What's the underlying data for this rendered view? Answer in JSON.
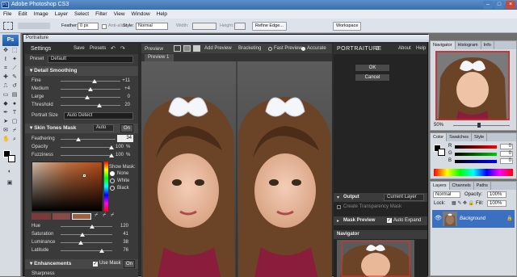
{
  "app": {
    "title": "Adobe Photoshop CS3",
    "logo": "Ps"
  },
  "menu": [
    "File",
    "Edit",
    "Image",
    "Layer",
    "Select",
    "Filter",
    "View",
    "Window",
    "Help"
  ],
  "options": {
    "feather_label": "Feather:",
    "feather_value": "0 px",
    "antialias": "Anti-alias",
    "style_label": "Style:",
    "style_value": "Normal",
    "width_label": "Width:",
    "height_label": "Height:",
    "refine": "Refine Edge...",
    "workspace": "Workspace"
  },
  "dialog": {
    "title": "Portraiture",
    "settings": {
      "header": "Settings",
      "save": "Save",
      "presets": "Presets",
      "preset_label": "Preset",
      "preset_value": "Default",
      "detail_header": "Detail Smoothing",
      "detail_rows": [
        {
          "label": "Fine",
          "value": "+11"
        },
        {
          "label": "Medium",
          "value": "+4"
        },
        {
          "label": "Large",
          "value": "0"
        },
        {
          "label": "Threshold",
          "value": "20"
        }
      ],
      "portrait_size_label": "Portrait Size",
      "portrait_size_value": "Auto Detect",
      "skin_header": "Skin Tones Mask",
      "skin_mode": "Auto",
      "skin_on": "On",
      "skin_rows": [
        {
          "label": "Feathering",
          "value": "34"
        },
        {
          "label": "Opacity",
          "value": "100",
          "unit": "%"
        },
        {
          "label": "Fuzziness",
          "value": "100",
          "unit": "%"
        }
      ],
      "show_mask_label": "Show Mask:",
      "show_mask_options": [
        "None",
        "White",
        "Black"
      ],
      "color_rows": [
        {
          "label": "Hue",
          "value": "120"
        },
        {
          "label": "Saturation",
          "value": "41"
        },
        {
          "label": "Luminance",
          "value": "38"
        },
        {
          "label": "Latitude",
          "value": "76"
        }
      ],
      "enh_header": "Enhancements",
      "use_mask": "Use Mask",
      "enh_on": "On",
      "sharpness_label": "Sharpness"
    },
    "preview": {
      "label": "Preview",
      "add_preview": "Add Preview",
      "bracketing": "Bracketing",
      "fast_preview": "Fast Preview",
      "accurate": "Accurate",
      "tab": "Preview 1"
    },
    "right": {
      "brand_a": "PORTRAITURE",
      "brand_b": "2",
      "about": "About",
      "help": "Help",
      "ok": "OK",
      "cancel": "Cancel",
      "output_label": "Output",
      "output_value": "Current Layer",
      "create_mask": "Create Transparency Mask",
      "mask_preview": "Mask Preview",
      "auto_expand": "Auto Expand",
      "navigator": "Navigator"
    }
  },
  "panels": {
    "nav_tabs": [
      "Navigator",
      "Histogram",
      "Info"
    ],
    "zoom": "50%",
    "color_tabs": [
      "Color",
      "Swatches",
      "Style"
    ],
    "color_letters": [
      "R",
      "G",
      "B"
    ],
    "color_values": [
      "0",
      "0",
      "0"
    ],
    "layer_tabs": [
      "Layers",
      "Channels",
      "Paths"
    ],
    "blend_mode": "Normal",
    "opacity_label": "Opacity:",
    "opacity_value": "100%",
    "lock_label": "Lock:",
    "fill_label": "Fill:",
    "fill_value": "100%",
    "layer_name": "Background"
  },
  "colors": {
    "accent_red": "#c03030",
    "ps_blue": "#2f6fc0",
    "mask_green": "#9acc44"
  }
}
